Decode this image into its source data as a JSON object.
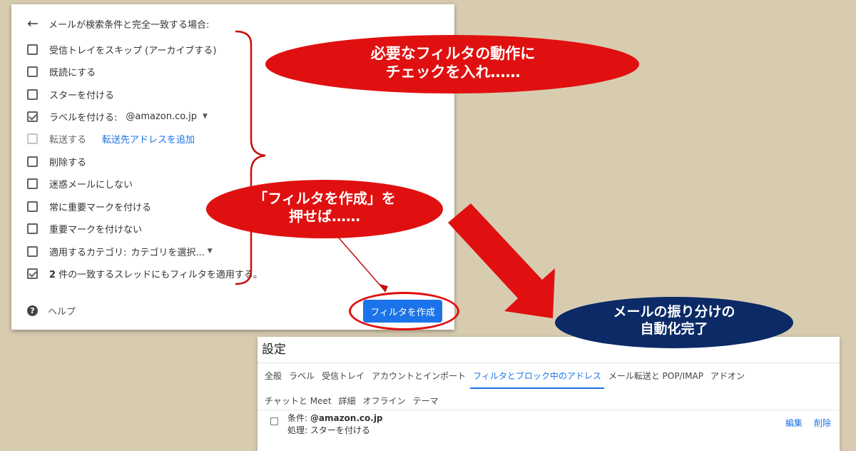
{
  "filter_dialog": {
    "back_icon": "arrow-left-icon",
    "title": "メールが検索条件と完全一致する場合:",
    "options": {
      "skip_inbox": "受信トレイをスキップ (アーカイブする)",
      "mark_read": "既読にする",
      "star": "スターを付ける",
      "apply_label": "ラベルを付ける:",
      "label_value": "@amazon.co.jp",
      "forward": "転送する",
      "forward_link": "転送先アドレスを追加",
      "delete": "削除する",
      "never_spam": "迷惑メールにしない",
      "always_important": "常に重要マークを付ける",
      "never_important": "重要マークを付けない",
      "category": "適用するカテゴリ:",
      "category_value": "カテゴリを選択...",
      "apply_existing_count": "2",
      "apply_existing": " 件の一致するスレッドにもフィルタを適用する。"
    },
    "checked": {
      "skip_inbox": false,
      "mark_read": false,
      "star": false,
      "apply_label": true,
      "forward": false,
      "delete": false,
      "never_spam": false,
      "always_important": false,
      "never_important": false,
      "category": false,
      "apply_existing": true
    },
    "help_icon": "help-circle-icon",
    "help_label": "ヘルプ",
    "create_button": "フィルタを作成"
  },
  "settings": {
    "title": "設定",
    "tabs_row1": [
      "全般",
      "ラベル",
      "受信トレイ",
      "アカウントとインポート",
      "フィルタとブロック中のアドレス",
      "メール転送と POP/IMAP",
      "アドオン"
    ],
    "active_tab": "フィルタとブロック中のアドレス",
    "tabs_row2": [
      "チャットと Meet",
      "詳細",
      "オフライン",
      "テーマ"
    ],
    "filter": {
      "condition_label": "条件:",
      "condition_value": "@amazon.co.jp",
      "action_label": "処理:",
      "action_value": "スターを付ける",
      "edit": "編集",
      "delete": "削除"
    }
  },
  "annotations": {
    "bubble1_line1": "必要なフィルタの動作に",
    "bubble1_line2": "チェックを入れ……",
    "bubble2_line1": "「フィルタを作成」を",
    "bubble2_line2": "押せば……",
    "bubble3_line1": "メールの振り分けの",
    "bubble3_line2": "自動化完了",
    "colors": {
      "red": "#e01010",
      "navy": "#0b2a66"
    }
  }
}
